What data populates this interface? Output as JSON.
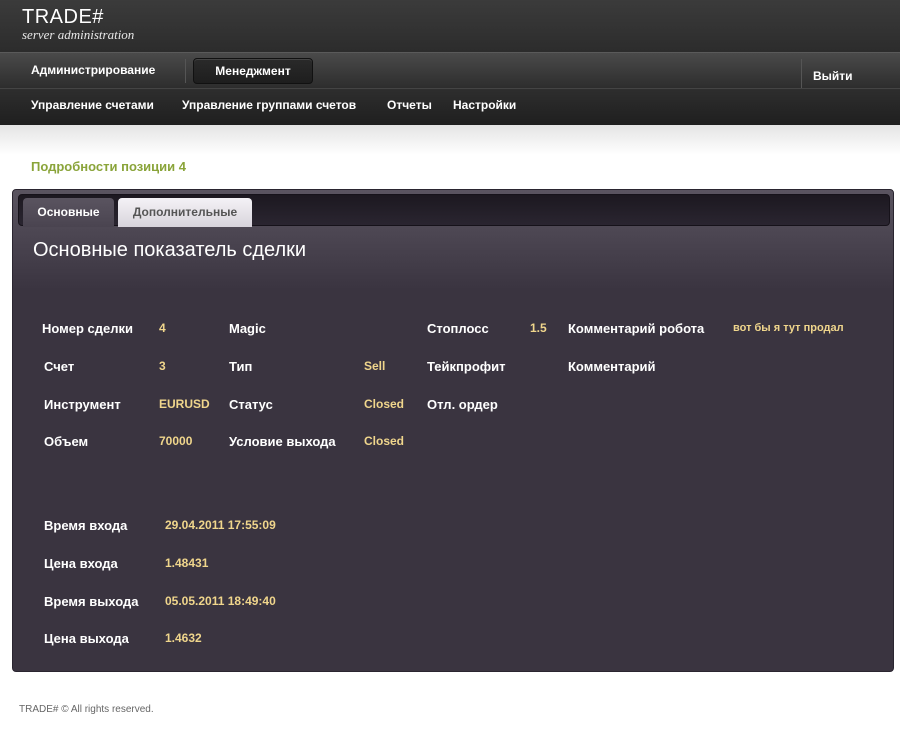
{
  "app": {
    "title": "TRADE#",
    "subtitle": "server administration"
  },
  "main_nav": {
    "admin": "Администрирование",
    "management": "Менеджмент",
    "logout": "Выйти"
  },
  "sub_nav": [
    "Управление счетами",
    "Управление группами счетов",
    "Отчеты",
    "Настройки"
  ],
  "page": {
    "title": "Подробности позиции 4"
  },
  "tabs": [
    {
      "label": "Основные",
      "active": true
    },
    {
      "label": "Дополнительные",
      "active": false
    }
  ],
  "section": {
    "heading": "Основные показатель сделки"
  },
  "fields": {
    "deal_number": {
      "label": "Номер сделки",
      "value": "4"
    },
    "account": {
      "label": "Счет",
      "value": "3"
    },
    "instrument": {
      "label": "Инструмент",
      "value": "EURUSD"
    },
    "volume": {
      "label": "Объем",
      "value": "70000"
    },
    "magic": {
      "label": "Magic",
      "value": ""
    },
    "type": {
      "label": "Тип",
      "value": "Sell"
    },
    "status": {
      "label": "Статус",
      "value": "Closed"
    },
    "exit_condition": {
      "label": "Условие выхода",
      "value": "Closed"
    },
    "stoploss": {
      "label": "Стоплосс",
      "value": "1.5"
    },
    "takeprofit": {
      "label": "Тейкпрофит",
      "value": ""
    },
    "pending_order": {
      "label": "Отл. ордер",
      "value": ""
    },
    "robot_comment": {
      "label": "Комментарий робота",
      "value": "вот бы я тут продал"
    },
    "comment": {
      "label": "Комментарий",
      "value": ""
    },
    "entry_time": {
      "label": "Время входа",
      "value": "29.04.2011 17:55:09"
    },
    "entry_price": {
      "label": "Цена входа",
      "value": "1.48431"
    },
    "exit_time": {
      "label": "Время выхода",
      "value": "05.05.2011 18:49:40"
    },
    "exit_price": {
      "label": "Цена выхода",
      "value": "1.4632"
    }
  },
  "footer": {
    "text": "TRADE# © All rights reserved."
  },
  "colors": {
    "accent_title": "#8aa43a",
    "value_text": "#f0d68c",
    "panel_bg": "#3a3440"
  }
}
